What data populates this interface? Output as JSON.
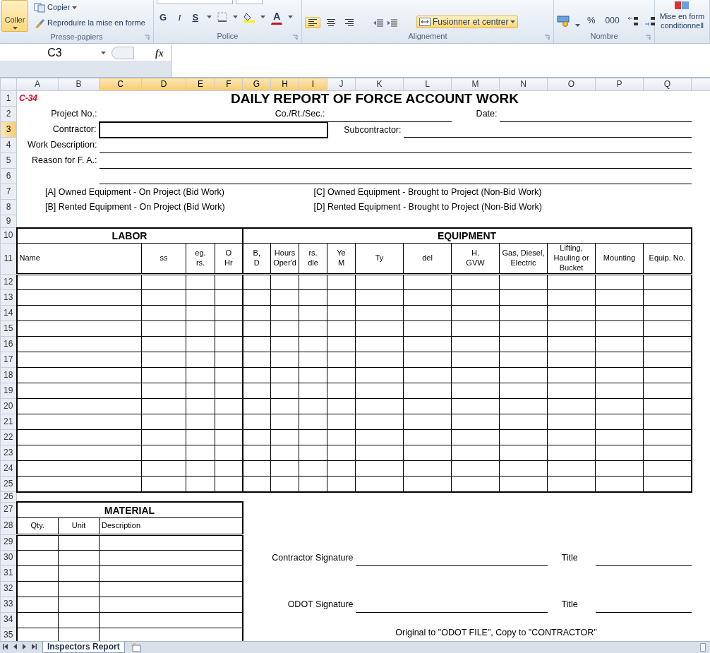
{
  "ribbon": {
    "groups": [
      {
        "kind": "clipboard",
        "label": "Presse-papiers",
        "paste": {
          "label": "Coller",
          "selected": true
        },
        "copy": "Copier",
        "format_painter": "Reproduire la mise en forme"
      },
      {
        "kind": "font",
        "label": "Police",
        "bold": "G",
        "italic": "I",
        "underline": "S",
        "font_color": "A"
      },
      {
        "kind": "alignment",
        "label": "Alignement",
        "align": [
          {
            "selected": true
          },
          {
            "selected": false
          },
          {
            "selected": false
          }
        ],
        "merge": {
          "label": "Fusionner et centrer",
          "selected": true
        }
      },
      {
        "kind": "number",
        "label": "Nombre",
        "percent": "%",
        "thousands": "000"
      },
      {
        "kind": "styles",
        "button": "Mise en form\nconditionnell"
      }
    ]
  },
  "name_box": "C3",
  "fx": "fx",
  "columns": [
    {
      "label": "A",
      "selected": false
    },
    {
      "label": "B",
      "selected": false
    },
    {
      "label": "C",
      "selected": true
    },
    {
      "label": "D",
      "selected": true
    },
    {
      "label": "E",
      "selected": true
    },
    {
      "label": "F",
      "selected": true
    },
    {
      "label": "G",
      "selected": true
    },
    {
      "label": "H",
      "selected": true
    },
    {
      "label": "I",
      "selected": true
    },
    {
      "label": "J",
      "selected": false
    },
    {
      "label": "K",
      "selected": false
    },
    {
      "label": "L",
      "selected": false
    },
    {
      "label": "M",
      "selected": false
    },
    {
      "label": "N",
      "selected": false
    },
    {
      "label": "O",
      "selected": false
    },
    {
      "label": "P",
      "selected": false
    },
    {
      "label": "Q",
      "selected": false
    }
  ],
  "rows": [
    {
      "label": "1",
      "selected": false
    },
    {
      "label": "2",
      "selected": false
    },
    {
      "label": "3",
      "selected": true
    },
    {
      "label": "4",
      "selected": false
    },
    {
      "label": "5",
      "selected": false
    },
    {
      "label": "6",
      "selected": false
    },
    {
      "label": "7",
      "selected": false
    },
    {
      "label": "8",
      "selected": false
    },
    {
      "label": "9",
      "selected": false
    },
    {
      "label": "10",
      "selected": false
    },
    {
      "label": "11",
      "selected": false
    },
    {
      "label": "12",
      "selected": false
    },
    {
      "label": "13",
      "selected": false
    },
    {
      "label": "14",
      "selected": false
    },
    {
      "label": "15",
      "selected": false
    },
    {
      "label": "16",
      "selected": false
    },
    {
      "label": "17",
      "selected": false
    },
    {
      "label": "18",
      "selected": false
    },
    {
      "label": "19",
      "selected": false
    },
    {
      "label": "20",
      "selected": false
    },
    {
      "label": "21",
      "selected": false
    },
    {
      "label": "22",
      "selected": false
    },
    {
      "label": "23",
      "selected": false
    },
    {
      "label": "24",
      "selected": false
    },
    {
      "label": "25",
      "selected": false
    },
    {
      "label": "26",
      "selected": false
    },
    {
      "label": "27",
      "selected": false
    },
    {
      "label": "28",
      "selected": false
    },
    {
      "label": "29",
      "selected": false
    },
    {
      "label": "30",
      "selected": false
    },
    {
      "label": "31",
      "selected": false
    },
    {
      "label": "32",
      "selected": false
    },
    {
      "label": "33",
      "selected": false
    },
    {
      "label": "34",
      "selected": false
    },
    {
      "label": "35",
      "selected": false
    }
  ],
  "form": {
    "code": "C-34",
    "title": "DAILY REPORT OF FORCE ACCOUNT WORK",
    "project_no": "Project No.:",
    "co_rt_sec": "Co./Rt./Sec.:",
    "date": "Date:",
    "contractor": "Contractor:",
    "subcontractor": "Subcontractor:",
    "work_description": "Work Description:",
    "reason": "Reason for F. A.:",
    "legend": [
      "[A] Owned Equipment - On Project (Bid Work)",
      "[C] Owned Equipment - Brought to Project (Non-Bid Work)",
      "[B] Rented Equipment - On Project (Bid Work)",
      "[D] Rented Equipment - Brought to Project (Non-Bid Work)"
    ],
    "labor": {
      "title": "LABOR",
      "columns": [
        "Name",
        "ss",
        "eg.\nrs.",
        "O\nHr"
      ]
    },
    "equipment": {
      "title": "EQUIPMENT",
      "columns": [
        "B,\nD",
        "Hours\nOper'd",
        "rs.\ndle",
        "Ye\nM",
        "Ty",
        "del",
        "H.\nGVW",
        "Gas, Diesel,\nElectric",
        "Lifting,\nHauling or\nBucket",
        "Mounting",
        "Equip. No."
      ]
    },
    "material": {
      "title": "MATERIAL",
      "columns": [
        "Qty.",
        "Unit",
        "Description"
      ]
    },
    "signatures": [
      {
        "label": "Contractor Signature",
        "title_label": "Title"
      },
      {
        "label": "ODOT Signature",
        "title_label": "Title"
      }
    ],
    "footer_note": "Original to \"ODOT FILE\", Copy to \"CONTRACTOR\""
  },
  "sheet_tabs": [
    {
      "label": "Inspectors Report",
      "selected": true
    }
  ]
}
